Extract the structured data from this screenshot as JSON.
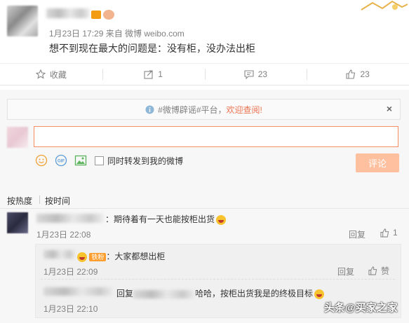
{
  "post": {
    "meta": "1月23日 17:29 来自 微博 weibo.com",
    "text": "想不到现在最大的问题是：没有柜，没办法出柜"
  },
  "actions": [
    {
      "icon": "star-icon",
      "label": "收藏"
    },
    {
      "icon": "forward-icon",
      "label": "1"
    },
    {
      "icon": "comment-icon",
      "label": "23"
    },
    {
      "icon": "like-icon",
      "label": "23"
    }
  ],
  "notice": {
    "prefix": "#微博辟谣#平台，",
    "link": "欢迎查阅!",
    "close": "×"
  },
  "composer": {
    "forward_label": "同时转发到我的微博",
    "submit_label": "评论"
  },
  "sort": {
    "by_hot": "按热度",
    "by_time": "按时间"
  },
  "comments": {
    "main": {
      "text": "：期待着有一天也能按柜出货",
      "time": "1月23日 22:08",
      "reply": "回复",
      "likes": "1"
    },
    "sub1": {
      "badge": "铁粉",
      "text": "：大家都想出柜",
      "time": "1月23日 22:09",
      "reply": "回复",
      "like": "赞"
    },
    "sub2": {
      "reply_prefix": "回复",
      "text": "哈哈，按柜出货我是的终极目标",
      "time": "1月23日 22:10",
      "reply": "回复",
      "like": "赞"
    }
  },
  "watermark": "头条@买家之家",
  "colors": {
    "accent": "#eb7350",
    "submit_disabled": "#ffc09f",
    "input_border": "#f78e63"
  }
}
